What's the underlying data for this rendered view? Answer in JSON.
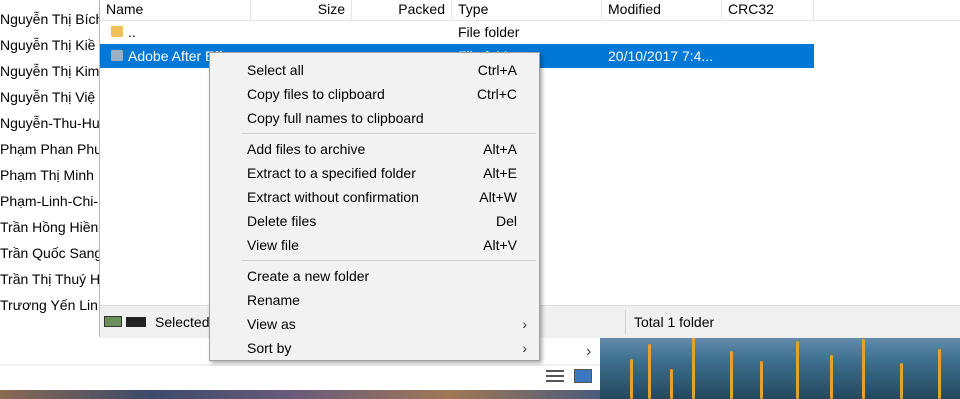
{
  "background_list": [
    "Nguyễn Thị Bích",
    "Nguyễn Thị Kiề",
    "Nguyễn Thị Kim",
    "Nguyễn Thị Việ",
    "Nguyễn-Thu-Hu",
    "Phạm Phan Phư",
    "Phạm Thị Minh",
    "Phạm-Linh-Chi-",
    "Trần Hồng Hiền",
    "Trần Quốc Sang",
    "Trần Thị Thuý H",
    "Trương Yến Linh"
  ],
  "columns": {
    "name": "Name",
    "size": "Size",
    "packed": "Packed",
    "type": "Type",
    "modified": "Modified",
    "crc": "CRC32"
  },
  "files": [
    {
      "name": "..",
      "type": "File folder",
      "modified": "",
      "selected": false
    },
    {
      "name": "Adobe After Eff",
      "type": "File fold",
      "modified": "20/10/2017 7:4...",
      "selected": true
    }
  ],
  "status": {
    "left": "Selected",
    "right": "Total 1 folder"
  },
  "controls": {
    "chevron": "›"
  },
  "context_menu": {
    "groups": [
      [
        {
          "label": "Select all",
          "shortcut": "Ctrl+A"
        },
        {
          "label": "Copy files to clipboard",
          "shortcut": "Ctrl+C"
        },
        {
          "label": "Copy full names to clipboard",
          "shortcut": ""
        }
      ],
      [
        {
          "label": "Add files to archive",
          "shortcut": "Alt+A"
        },
        {
          "label": "Extract to a specified folder",
          "shortcut": "Alt+E"
        },
        {
          "label": "Extract without confirmation",
          "shortcut": "Alt+W"
        },
        {
          "label": "Delete files",
          "shortcut": "Del"
        },
        {
          "label": "View file",
          "shortcut": "Alt+V"
        }
      ],
      [
        {
          "label": "Create a new folder",
          "shortcut": ""
        },
        {
          "label": "Rename",
          "shortcut": ""
        },
        {
          "label": "View as",
          "shortcut": "",
          "submenu": true
        },
        {
          "label": "Sort by",
          "shortcut": "",
          "submenu": true
        }
      ]
    ],
    "submenu_arrow": "›"
  },
  "colors": {
    "selection": "#0078d7",
    "menu_background": "#f2f2f2",
    "status_background": "#f0f0f0"
  }
}
